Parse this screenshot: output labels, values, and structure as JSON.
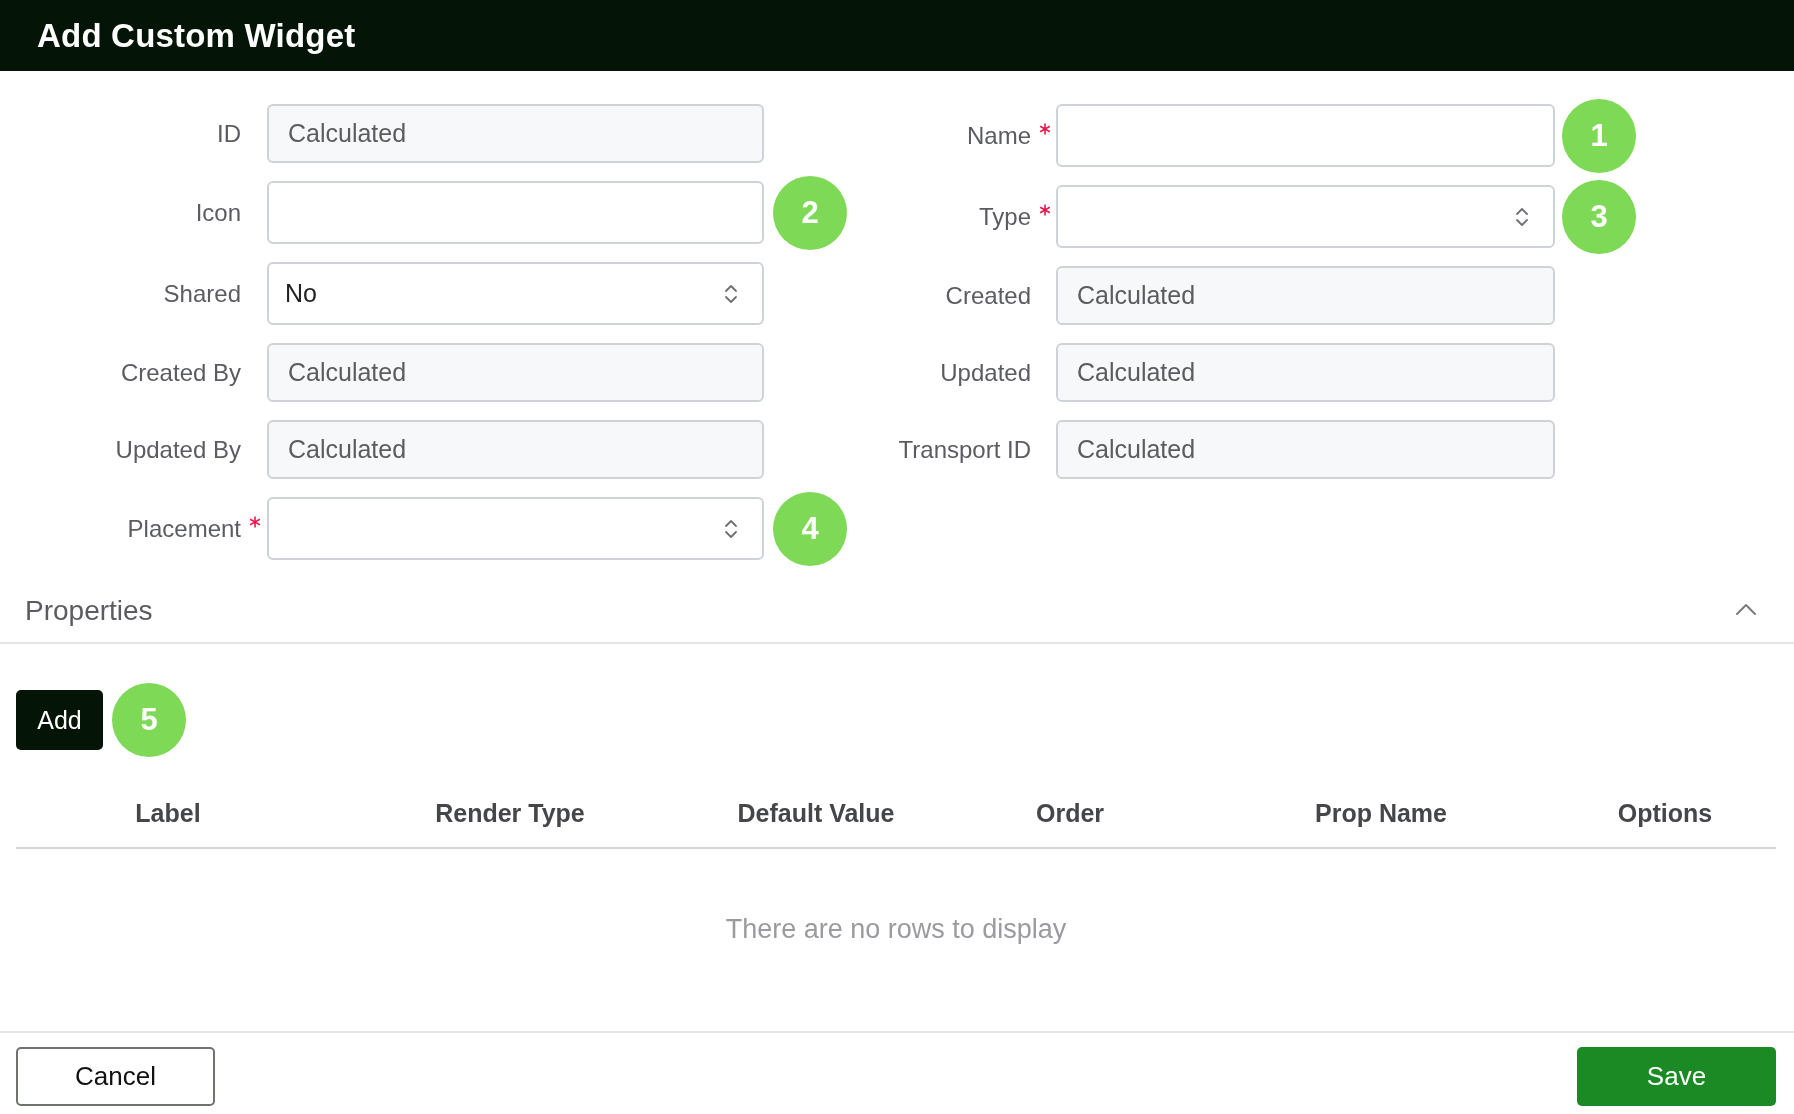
{
  "dialog": {
    "title": "Add Custom Widget"
  },
  "form": {
    "left_fields": [
      {
        "label": "ID",
        "kind": "text",
        "disabled": true,
        "required": false,
        "value": "Calculated"
      },
      {
        "label": "Icon",
        "kind": "text",
        "disabled": false,
        "required": false,
        "callout": "2"
      },
      {
        "label": "Shared",
        "kind": "select",
        "disabled": false,
        "required": false,
        "value": "No"
      },
      {
        "label": "Created By",
        "kind": "text",
        "disabled": true,
        "required": false,
        "value": "Calculated"
      },
      {
        "label": "Updated By",
        "kind": "text",
        "disabled": true,
        "required": false,
        "value": "Calculated"
      },
      {
        "label": "Placement",
        "kind": "select",
        "disabled": false,
        "required": true,
        "callout": "4"
      }
    ],
    "right_fields": [
      {
        "label": "Name",
        "kind": "text",
        "disabled": false,
        "required": true,
        "callout": "1"
      },
      {
        "label": "Type",
        "kind": "select",
        "disabled": false,
        "required": true,
        "callout": "3"
      },
      {
        "label": "Created",
        "kind": "text",
        "disabled": true,
        "required": false,
        "value": "Calculated"
      },
      {
        "label": "Updated",
        "kind": "text",
        "disabled": true,
        "required": false,
        "value": "Calculated"
      },
      {
        "label": "Transport ID",
        "kind": "text",
        "disabled": true,
        "required": false,
        "value": "Calculated"
      }
    ]
  },
  "properties": {
    "title": "Properties",
    "expanded": true,
    "add_button": "Add",
    "add_callout": "5",
    "table": {
      "columns": [
        "Label",
        "Render Type",
        "Default Value",
        "Order",
        "Prop Name",
        "Options"
      ],
      "empty_message": "There are no rows to display"
    }
  },
  "footer": {
    "cancel": "Cancel",
    "save": "Save"
  }
}
